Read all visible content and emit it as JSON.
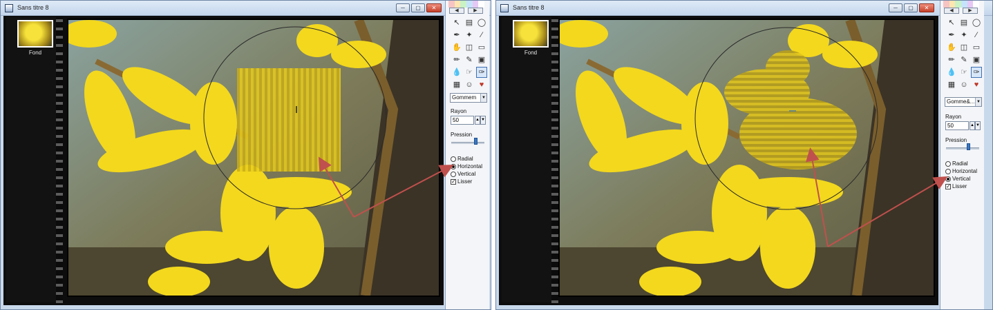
{
  "window_a": {
    "title": "Sans titre 8",
    "layer_name": "Fond",
    "brush": "Gommem",
    "radius_label": "Rayon",
    "radius_value": "50",
    "pressure_label": "Pression",
    "mode_options": [
      "Radial",
      "Horizontal",
      "Vertical"
    ],
    "selected_mode": "Horizontal",
    "smooth_label": "Lisser",
    "smooth_checked": true
  },
  "window_b": {
    "title": "Sans titre 8",
    "layer_name": "Fond",
    "brush": "Gomme&...",
    "radius_label": "Rayon",
    "radius_value": "50",
    "pressure_label": "Pression",
    "mode_options": [
      "Radial",
      "Horizontal",
      "Vertical"
    ],
    "selected_mode": "Vertical",
    "smooth_label": "Lisser",
    "smooth_checked": true
  },
  "icons": {
    "window_controls": [
      "minimize-icon",
      "maximize-icon",
      "close-icon"
    ],
    "nav": [
      "arrow-left-icon",
      "arrow-right-icon"
    ]
  },
  "colors": {
    "annotation_arrow": "#c0504d",
    "palette": [
      "#f7c4c4",
      "#fde6b1",
      "#c9f2c5",
      "#c5e4fb",
      "#e6c8f6",
      "#ffffff"
    ],
    "flower": "#f2d81c",
    "background_sky": "#a9c6de"
  }
}
